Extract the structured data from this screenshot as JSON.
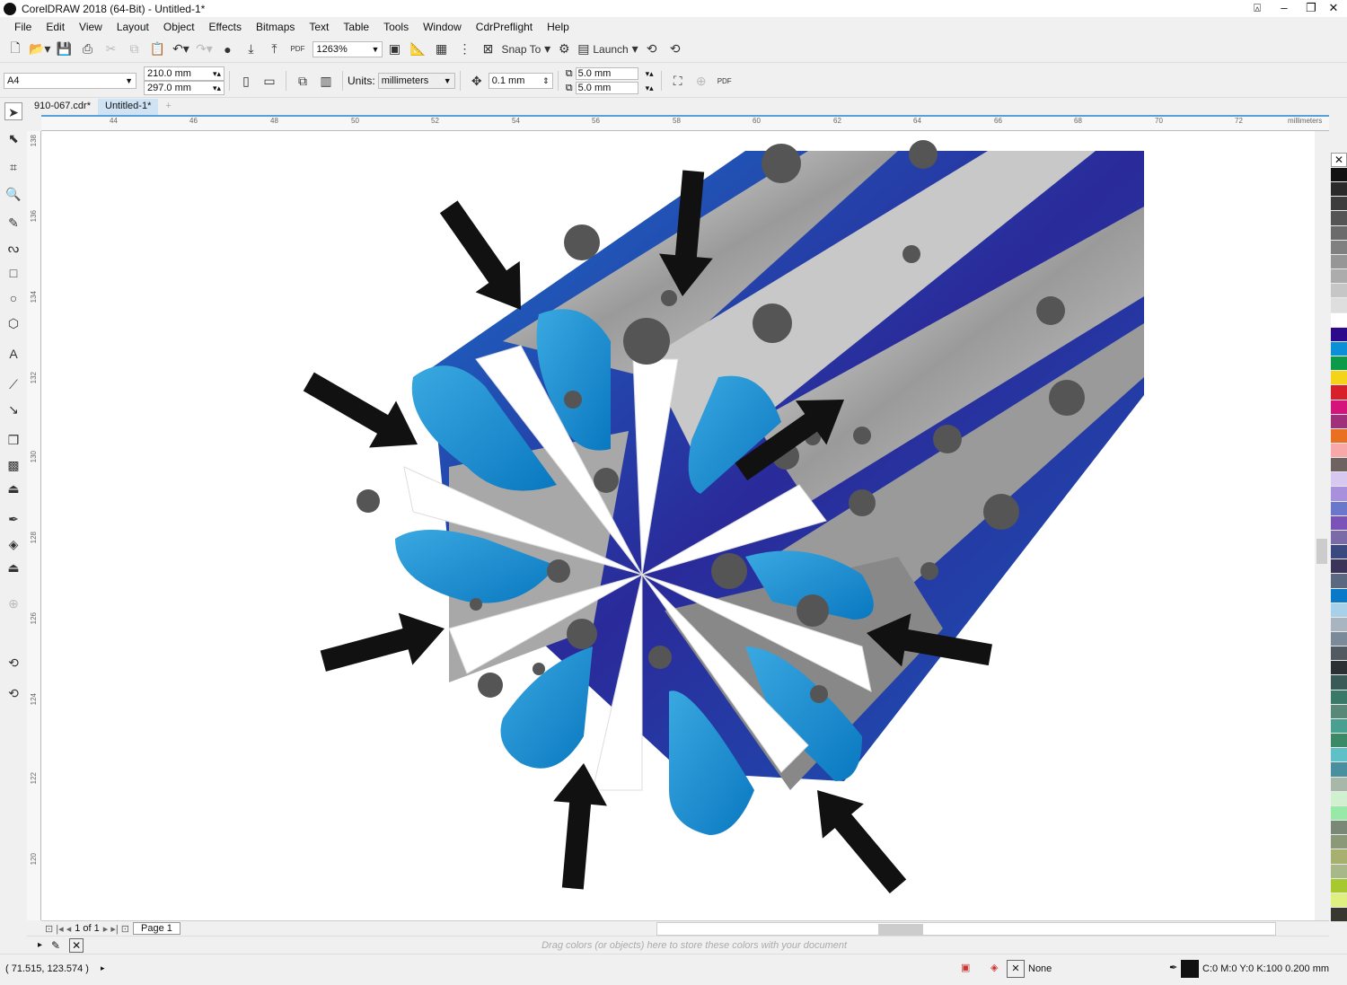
{
  "window": {
    "title": "CorelDRAW 2018 (64-Bit) - Untitled-1*"
  },
  "menu": [
    "File",
    "Edit",
    "View",
    "Layout",
    "Object",
    "Effects",
    "Bitmaps",
    "Text",
    "Table",
    "Tools",
    "Window",
    "CdrPreflight",
    "Help"
  ],
  "toolbar": {
    "zoom": "1263%",
    "snap_to": "Snap To",
    "launch": "Launch",
    "pdf": "PDF"
  },
  "property_bar": {
    "page_size": "A4",
    "width": "210.0 mm",
    "height": "297.0 mm",
    "units_label": "Units:",
    "units": "millimeters",
    "nudge": "0.1 mm",
    "dup_x": "5.0 mm",
    "dup_y": "5.0 mm",
    "pdf": "PDF"
  },
  "tabs": [
    "910-067.cdr*",
    "Untitled-1*"
  ],
  "rulers": {
    "h_ticks": [
      "44",
      "46",
      "48",
      "50",
      "52",
      "54",
      "56",
      "58",
      "60",
      "62",
      "64",
      "66",
      "68",
      "70",
      "72"
    ],
    "h_unit": "millimeters",
    "v_ticks": [
      "138",
      "136",
      "134",
      "132",
      "130",
      "128",
      "126",
      "124",
      "122",
      "120"
    ]
  },
  "palette": [
    "#111111",
    "#2a2a2a",
    "#3d3d3d",
    "#555555",
    "#6b6b6b",
    "#808080",
    "#969696",
    "#acacac",
    "#c6c6c6",
    "#dedede",
    "#ffffff",
    "#2d0a8c",
    "#0b8fd6",
    "#0a9a4a",
    "#f3d41a",
    "#d8202a",
    "#d5137d",
    "#a0307a",
    "#e87020",
    "#f8a8a8",
    "#6e6360",
    "#d6c8f0",
    "#a890dc",
    "#6a78cc",
    "#7a52b8",
    "#7a6aa8",
    "#3a4a80",
    "#3c3458",
    "#5a6880",
    "#0a7ac8",
    "#a8d0e8",
    "#a8b4c0",
    "#7a8a98",
    "#505a60",
    "#2a3034",
    "#3a5a58",
    "#3a7868",
    "#5a8878",
    "#4aa090",
    "#3a8a68",
    "#60c0c8",
    "#4890a0",
    "#a8b8a8",
    "#d0f0d0",
    "#98e8a8",
    "#7a8878",
    "#8a9a78",
    "#a8b070",
    "#a8b888",
    "#a8c830",
    "#e0f080",
    "#383830"
  ],
  "page_nav": {
    "current": "1",
    "of": "of",
    "total": "1",
    "page_tab": "Page 1"
  },
  "docker": {
    "hint": "Drag colors (or objects) here to store these colors with your document"
  },
  "status": {
    "coords": "( 71.515, 123.574 )",
    "fill": "None",
    "outline": "C:0 M:0 Y:0 K:100  0.200 mm"
  }
}
